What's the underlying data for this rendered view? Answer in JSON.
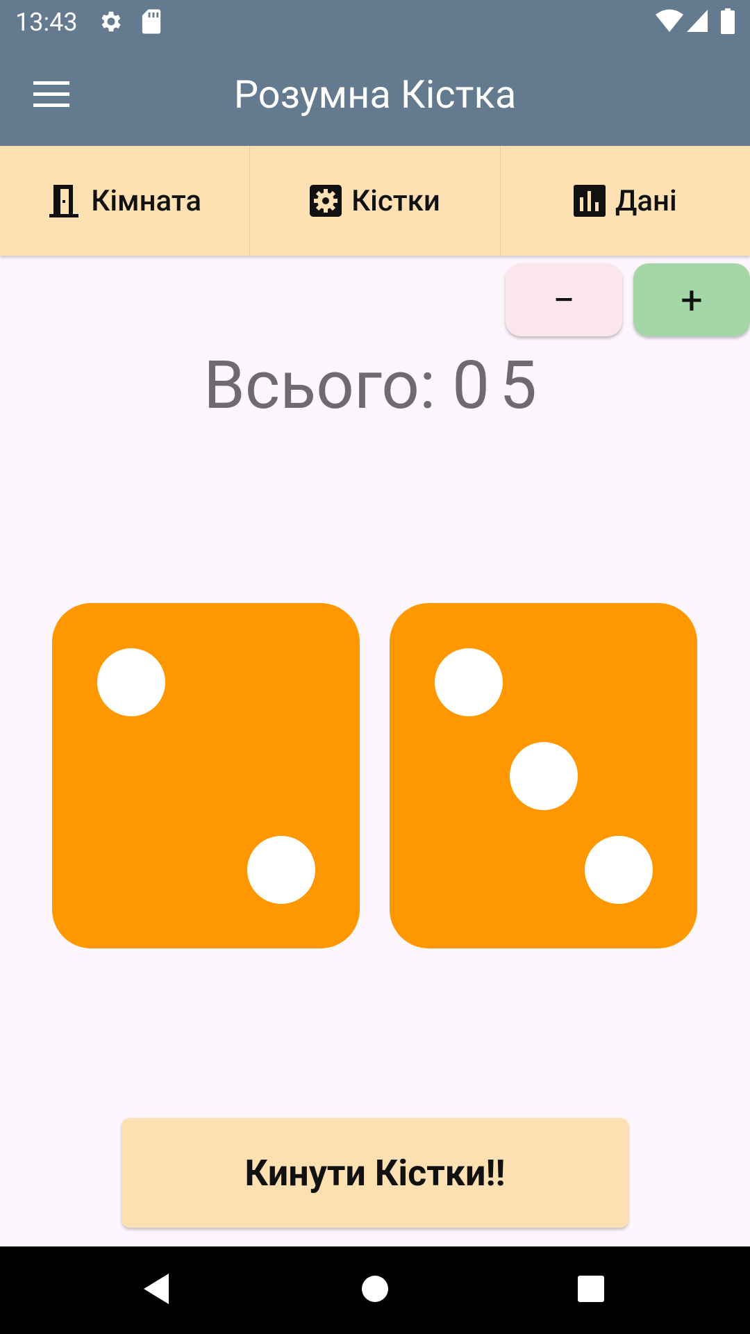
{
  "status_bar": {
    "time": "13:43",
    "left_icons": [
      "gear-icon",
      "sd-card-icon"
    ],
    "right_icons": [
      "wifi-icon",
      "signal-icon",
      "battery-icon"
    ]
  },
  "app_bar": {
    "title": "Розумна Кістка",
    "menu_icon": "hamburger-menu-icon",
    "color": "#637a8f"
  },
  "tabs": [
    {
      "label": "Кімната",
      "icon": "door-icon"
    },
    {
      "label": "Кістки",
      "icon": "settings-box-icon"
    },
    {
      "label": "Дані",
      "icon": "bar-chart-icon"
    }
  ],
  "controls": {
    "minus_label": "−",
    "plus_label": "+"
  },
  "total": {
    "label": "Всього:",
    "value": "05"
  },
  "dice": [
    {
      "value": 2,
      "color": "#ff9800"
    },
    {
      "value": 3,
      "color": "#ff9800"
    }
  ],
  "roll_button": {
    "label": "Кинути Кістки!!"
  },
  "nav_bar": {
    "icons": [
      "back-icon",
      "home-icon",
      "recents-icon"
    ]
  }
}
